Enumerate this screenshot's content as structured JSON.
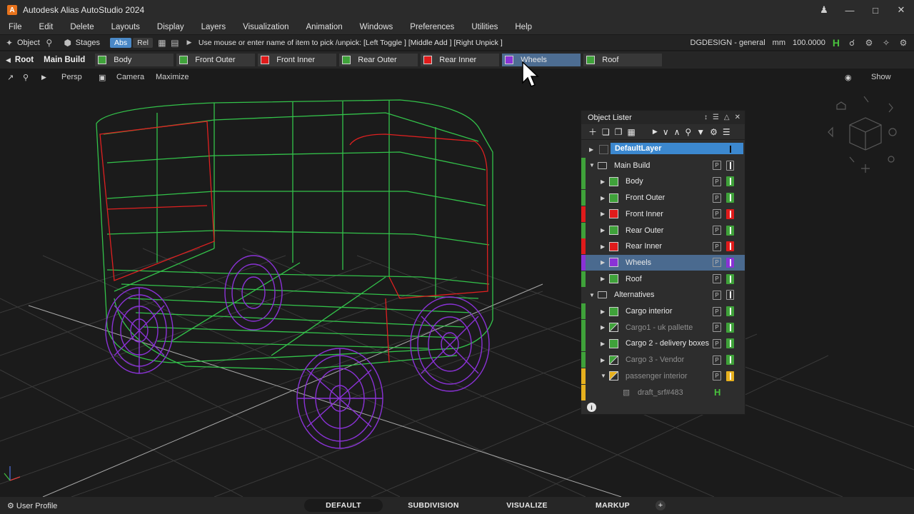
{
  "app": {
    "logo": "A",
    "title": "Autodesk Alias AutoStudio 2024",
    "win_controls": [
      "person-icon",
      "minimize-icon",
      "maximize-icon",
      "close-icon"
    ]
  },
  "menu": [
    "File",
    "Edit",
    "Delete",
    "Layouts",
    "Display",
    "Layers",
    "Visualization",
    "Animation",
    "Windows",
    "Preferences",
    "Utilities",
    "Help"
  ],
  "toolbar": {
    "object_label": "Object",
    "stages_label": "Stages",
    "abs_label": "Abs",
    "rel_label": "Rel",
    "prompt": "Use mouse or enter name of item to pick /unpick: [Left Toggle ] [Middle Add ] [Right Unpick ]",
    "workspace": "DGDESIGN - general",
    "units": "mm",
    "scale": "100.0000",
    "h_label": "H"
  },
  "layerbar": {
    "root_label": "Root",
    "main_label": "Main Build",
    "tabs": [
      {
        "label": "Body",
        "color": "#3fa23a"
      },
      {
        "label": "Front Outer",
        "color": "#3fa23a"
      },
      {
        "label": "Front Inner",
        "color": "#e01b1b"
      },
      {
        "label": "Rear Outer",
        "color": "#3fa23a"
      },
      {
        "label": "Rear Inner",
        "color": "#e01b1b"
      },
      {
        "label": "Wheels",
        "color": "#8a32d6"
      },
      {
        "label": "Roof",
        "color": "#3fa23a"
      }
    ]
  },
  "viewport_toolbar": {
    "persp": "Persp",
    "camera": "Camera",
    "maximize": "Maximize",
    "show": "Show"
  },
  "lister": {
    "title": "Object Lister",
    "p_label": "P",
    "rows": [
      {
        "label": "DefaultLayer",
        "kind": "default",
        "bar": ""
      },
      {
        "label": "Main Build",
        "kind": "folder",
        "expanded": true,
        "bar": "#3fa23a"
      },
      {
        "label": "Body",
        "kind": "layer",
        "color": "#3fa23a",
        "bar": "#3fa23a"
      },
      {
        "label": "Front Outer",
        "kind": "layer",
        "color": "#3fa23a",
        "bar": "#3fa23a"
      },
      {
        "label": "Front Inner",
        "kind": "layer",
        "color": "#e01b1b",
        "bar": "#e01b1b"
      },
      {
        "label": "Rear Outer",
        "kind": "layer",
        "color": "#3fa23a",
        "bar": "#3fa23a"
      },
      {
        "label": "Rear Inner",
        "kind": "layer",
        "color": "#e01b1b",
        "bar": "#e01b1b"
      },
      {
        "label": "Wheels",
        "kind": "layer",
        "color": "#8a32d6",
        "bar": "#8a32d6",
        "selected": true
      },
      {
        "label": "Roof",
        "kind": "layer",
        "color": "#3fa23a",
        "bar": "#3fa23a"
      },
      {
        "label": "Alternatives",
        "kind": "folder",
        "expanded": true,
        "bar": ""
      },
      {
        "label": "Cargo interior",
        "kind": "layer",
        "color": "#3fa23a",
        "bar": "#3fa23a"
      },
      {
        "label": "Cargo1 - uk pallette",
        "kind": "layer-off",
        "color": "#3fa23a",
        "bar": "#3fa23a"
      },
      {
        "label": "Cargo 2 - delivery boxes",
        "kind": "layer",
        "color": "#3fa23a",
        "bar": "#3fa23a"
      },
      {
        "label": "Cargo 3 - Vendor",
        "kind": "layer-off",
        "color": "#3fa23a",
        "bar": "#3fa23a"
      },
      {
        "label": "passenger interior",
        "kind": "layer-off-open",
        "color": "#e6b01e",
        "bar": "#e6b01e"
      },
      {
        "label": "draft_srf#483",
        "kind": "surface",
        "bar": "#e6b01e"
      }
    ]
  },
  "bottom": {
    "user_profile": "User Profile",
    "tabs": [
      "DEFAULT",
      "SUBDIVISION",
      "VISUALIZE",
      "MARKUP"
    ],
    "active": "DEFAULT",
    "add_label": "+"
  }
}
